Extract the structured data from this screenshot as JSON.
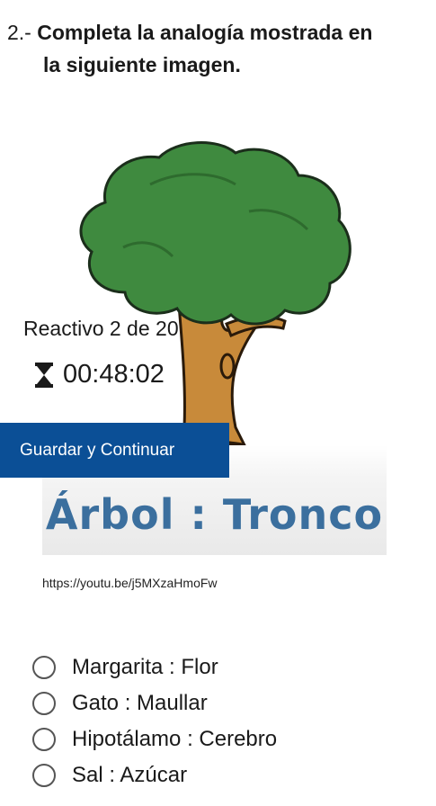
{
  "question": {
    "number": "2.-",
    "text_line1": "Completa la analogía mostrada en",
    "text_line2": "la siguiente imagen."
  },
  "figure": {
    "analogy_text": "Árbol : Tronco"
  },
  "overlay": {
    "counter": "Reactivo 2 de 20",
    "timer": "00:48:02",
    "timer_icon": "hourglass-icon",
    "save_label": "Guardar y Continuar"
  },
  "source_link": "https://youtu.be/j5MXzaHmoFw",
  "options": [
    {
      "label": "Margarita : Flor"
    },
    {
      "label": "Gato : Maullar"
    },
    {
      "label": "Hipotálamo : Cerebro"
    },
    {
      "label": "Sal : Azúcar"
    }
  ],
  "colors": {
    "button_bg": "#0b4f96",
    "analogy_text": "#3b6f9e",
    "foliage": "#3f8a3f",
    "trunk": "#c88a3a"
  }
}
